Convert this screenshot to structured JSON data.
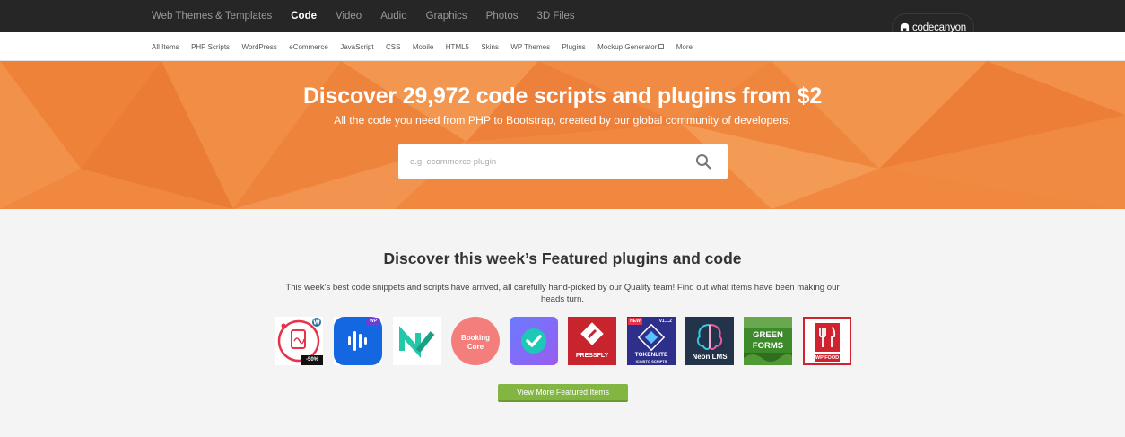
{
  "topnav": {
    "items": [
      {
        "label": "Web Themes & Templates",
        "active": false
      },
      {
        "label": "Code",
        "active": true
      },
      {
        "label": "Video",
        "active": false
      },
      {
        "label": "Audio",
        "active": false
      },
      {
        "label": "Graphics",
        "active": false
      },
      {
        "label": "Photos",
        "active": false
      },
      {
        "label": "3D Files",
        "active": false
      }
    ],
    "logo_text": "codecanyon"
  },
  "subnav": {
    "items": [
      "All Items",
      "PHP Scripts",
      "WordPress",
      "eCommerce",
      "JavaScript",
      "CSS",
      "Mobile",
      "HTML5",
      "Skins",
      "WP Themes",
      "Plugins",
      "Mockup Generator",
      "More"
    ]
  },
  "hero": {
    "title": "Discover 29,972 code scripts and plugins from $2",
    "subtitle": "All the code you need from PHP to Bootstrap, created by our global community of developers.",
    "search_placeholder": "e.g. ecommerce plugin"
  },
  "featured": {
    "title": "Discover this week’s Featured plugins and code",
    "description": "This week’s best code snippets and scripts have arrived, all carefully hand-picked by our Quality team! Find out what items have been making our heads turn.",
    "thumb_texts": {
      "discount": "-50%",
      "wp_badge": "WP",
      "booking_line1": "Booking",
      "booking_line2": "Core",
      "pressfly": "PRESSFLY",
      "token_new": "NEW",
      "token_version": "v1.1.2",
      "token_name": "TOKENLITE",
      "token_sub": "ICO/STO SCRIPTS",
      "neon": "Neon LMS",
      "green_line1": "GREEN",
      "green_line2": "FORMS",
      "wpfood": "WP FOOD"
    },
    "button_label": "View More Featured Items"
  },
  "colors": {
    "topbar": "#262626",
    "hero_orange": "#f0883f",
    "button_green": "#82b541"
  }
}
